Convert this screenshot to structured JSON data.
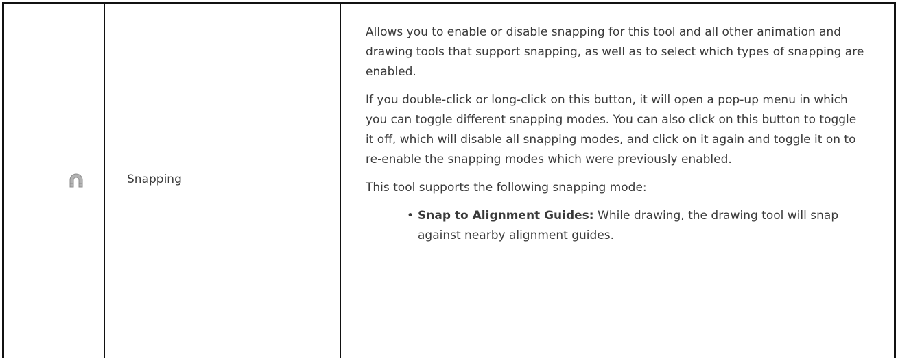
{
  "row": {
    "icon": "magnet-icon",
    "name": "Snapping",
    "description": {
      "paragraph_1": "Allows you to enable or disable snapping for this tool and all other animation and drawing tools that support snapping, as well as to select which types of snapping are enabled.",
      "paragraph_2": "If you double-click or long-click on this button, it will open a pop-up menu in which you can toggle different snapping modes. You can also click on this button to toggle it off, which will disable all snapping modes, and click on it again and toggle it on to re-enable the snapping modes which were previously enabled.",
      "paragraph_3": "This tool supports the following snapping mode:",
      "bullets": [
        {
          "title": "Snap to Alignment Guides:",
          "text": " While drawing, the drawing tool will snap against nearby alignment guides."
        }
      ]
    }
  },
  "colors": {
    "text": "#3a3a3a",
    "border": "#111111",
    "icon_fill": "#b3b3b3",
    "icon_stroke": "#8c8c8c"
  }
}
